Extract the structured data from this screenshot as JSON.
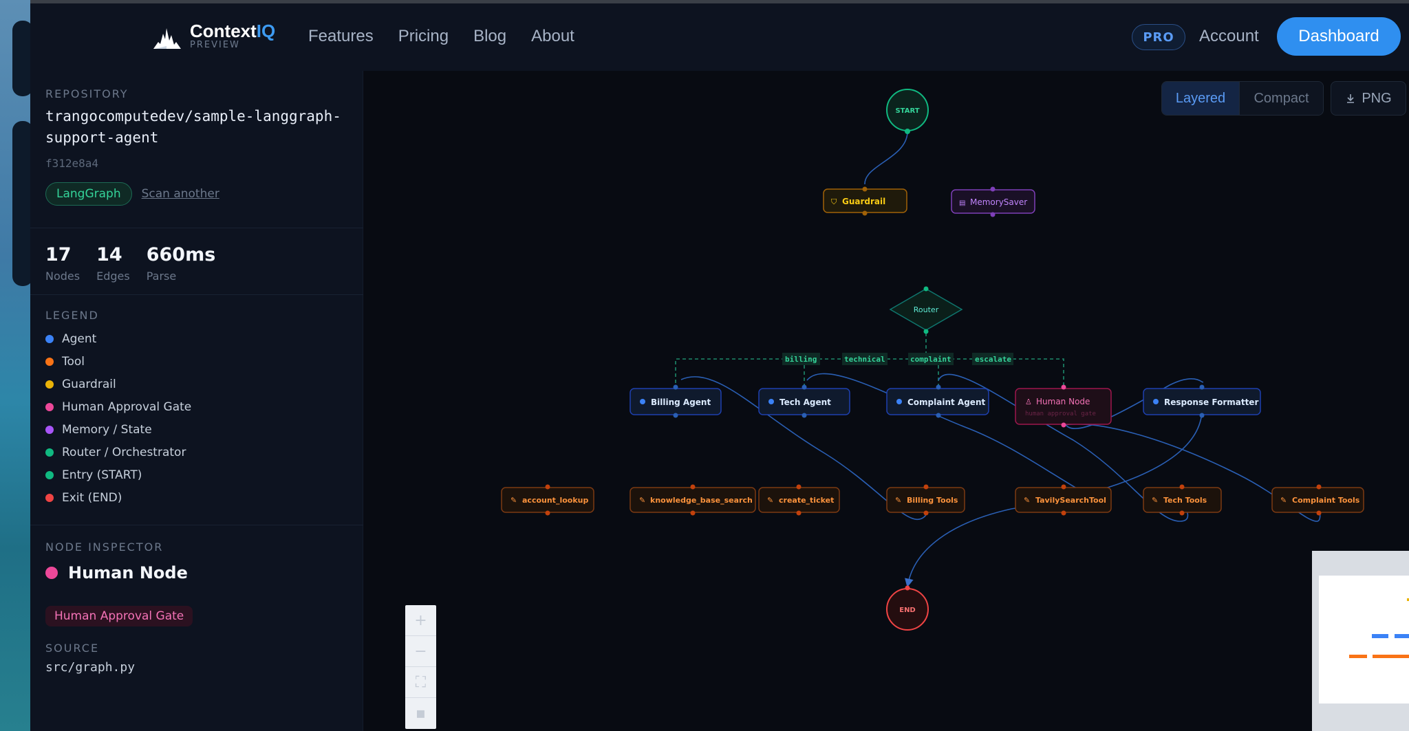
{
  "nav": {
    "brand_name": "Context",
    "brand_accent": "IQ",
    "brand_sub": "PREVIEW",
    "links": [
      "Features",
      "Pricing",
      "Blog",
      "About"
    ],
    "pro_badge": "PRO",
    "account": "Account",
    "dashboard": "Dashboard"
  },
  "sidebar": {
    "repo_caption": "REPOSITORY",
    "repo_name_line1": "trangocomputedev/sample-langgraph-",
    "repo_name_line2": "support-agent",
    "commit": "f312e8a4",
    "framework_tag": "LangGraph",
    "scan_another": "Scan another",
    "stats": [
      {
        "value": "17",
        "label": "Nodes"
      },
      {
        "value": "14",
        "label": "Edges"
      },
      {
        "value": "660ms",
        "label": "Parse"
      }
    ],
    "legend_caption": "LEGEND",
    "legend": [
      {
        "label": "Agent",
        "color": "#3b82f6"
      },
      {
        "label": "Tool",
        "color": "#f97316"
      },
      {
        "label": "Guardrail",
        "color": "#eab308"
      },
      {
        "label": "Human Approval Gate",
        "color": "#ec4899"
      },
      {
        "label": "Memory / State",
        "color": "#a855f7"
      },
      {
        "label": "Router / Orchestrator",
        "color": "#10b981"
      },
      {
        "label": "Entry (START)",
        "color": "#10b981"
      },
      {
        "label": "Exit (END)",
        "color": "#ef4444"
      }
    ],
    "inspector_caption": "NODE INSPECTOR",
    "inspector_node": "Human Node",
    "inspector_type": "Human Approval Gate",
    "source_caption": "SOURCE",
    "source_path": "src/graph.py"
  },
  "toolbar": {
    "layered": "Layered",
    "compact": "Compact",
    "png": "PNG"
  },
  "graph": {
    "start": "START",
    "end": "END",
    "guardrail": "Guardrail",
    "memory": "MemorySaver",
    "router": "Router",
    "edge_labels": [
      "billing",
      "technical",
      "complaint",
      "escalate"
    ],
    "agents": [
      "Billing Agent",
      "Tech Agent",
      "Complaint Agent",
      "Human Node",
      "Response Formatter"
    ],
    "human_sub": "human approval gate",
    "tools": [
      "account_lookup",
      "knowledge_base_search",
      "create_ticket",
      "Billing Tools",
      "TavilySearchTool",
      "Tech Tools",
      "Complaint Tools"
    ]
  }
}
